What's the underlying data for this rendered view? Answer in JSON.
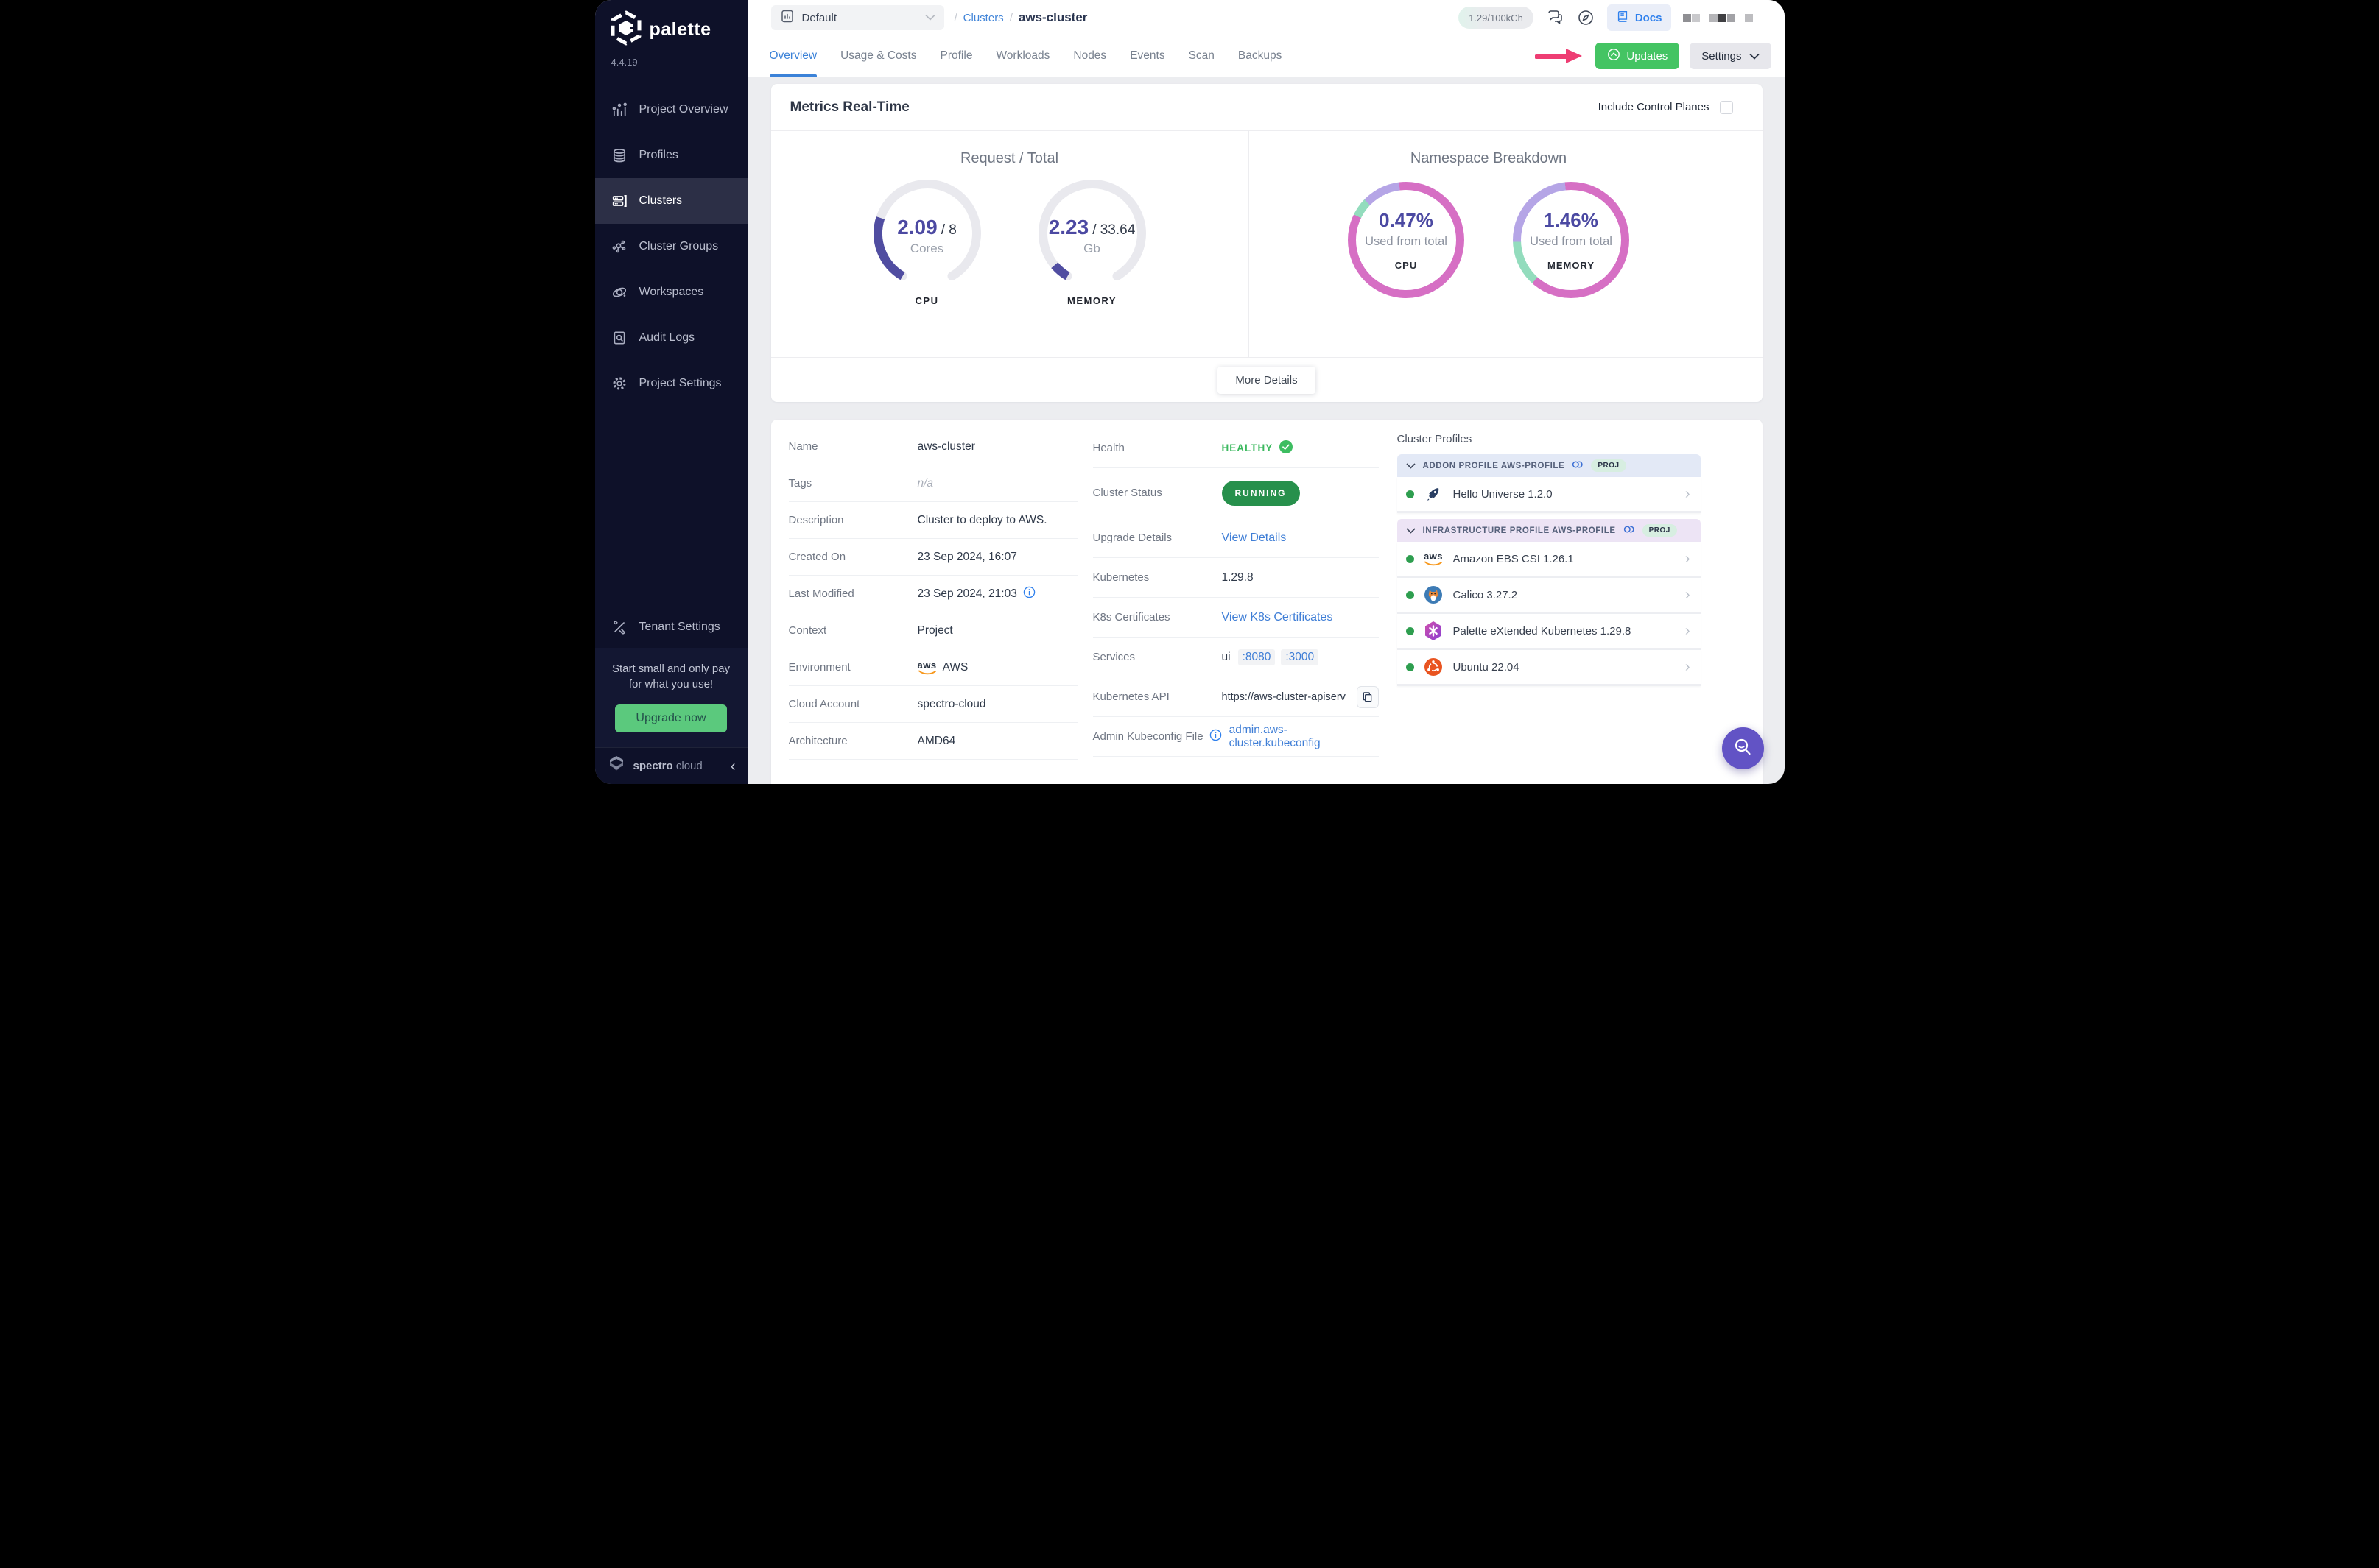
{
  "colors": {
    "sidebar_bg": "#0e1129",
    "accent_blue": "#3b82d8",
    "link_blue": "#3f7ed6",
    "green_button": "#44c463",
    "status_green": "#27904c",
    "healthy_green": "#3cb95f",
    "gauge_purple": "#504da1",
    "gauge_track": "#e9e9ee",
    "ring_pink": "#d66fc4",
    "ring_purple": "#b5a5e6",
    "ring_green": "#93dcbd",
    "promo_green": "#5bc97d",
    "annotation_pink": "#ee3d73",
    "fab_purple": "#6253c5"
  },
  "app": {
    "brand": "palette",
    "version": "4.4.19",
    "footer_brand_bold": "spectro",
    "footer_brand_light": "cloud"
  },
  "sidebar": {
    "items": [
      {
        "label": "Project Overview",
        "icon": "project-overview-icon",
        "active": false
      },
      {
        "label": "Profiles",
        "icon": "profiles-icon",
        "active": false
      },
      {
        "label": "Clusters",
        "icon": "clusters-icon",
        "active": true
      },
      {
        "label": "Cluster Groups",
        "icon": "cluster-groups-icon",
        "active": false
      },
      {
        "label": "Workspaces",
        "icon": "workspaces-icon",
        "active": false
      },
      {
        "label": "Audit Logs",
        "icon": "audit-logs-icon",
        "active": false
      },
      {
        "label": "Project Settings",
        "icon": "project-settings-icon",
        "active": false
      }
    ],
    "tenant_settings": "Tenant Settings",
    "promo": {
      "line1": "Start small and only pay",
      "line2": "for what you use!",
      "button": "Upgrade now"
    }
  },
  "topbar": {
    "project_selector": "Default",
    "breadcrumb": {
      "sep1": "/",
      "link": "Clusters",
      "sep2": "/",
      "current": "aws-cluster"
    },
    "usage_badge": "1.29/100kCh",
    "docs_label": "Docs"
  },
  "tabs": {
    "items": [
      {
        "label": "Overview",
        "active": true
      },
      {
        "label": "Usage & Costs",
        "active": false
      },
      {
        "label": "Profile",
        "active": false
      },
      {
        "label": "Workloads",
        "active": false
      },
      {
        "label": "Nodes",
        "active": false
      },
      {
        "label": "Events",
        "active": false
      },
      {
        "label": "Scan",
        "active": false
      },
      {
        "label": "Backups",
        "active": false
      }
    ]
  },
  "page_actions": {
    "updates": "Updates",
    "settings": "Settings"
  },
  "metrics_card": {
    "title": "Metrics Real-Time",
    "include_control_planes": "Include Control Planes",
    "request_total": {
      "title": "Request / Total",
      "gauges": [
        {
          "value": "2.09",
          "total": "/ 8",
          "unit": "Cores",
          "label": "CPU",
          "fraction": 0.261
        },
        {
          "value": "2.23",
          "total": "/ 33.64",
          "unit": "Gb",
          "label": "MEMORY",
          "fraction": 0.066
        }
      ]
    },
    "namespace_breakdown": {
      "title": "Namespace Breakdown",
      "rings": [
        {
          "percent": "0.47%",
          "caption": "Used from total",
          "label": "CPU",
          "segments": [
            [
              "#d66fc4",
              0,
              296
            ],
            [
              "#93dcbd",
              296,
              314
            ],
            [
              "#b5a5e6",
              314,
              353
            ],
            [
              "#d66fc4",
              353,
              360
            ]
          ]
        },
        {
          "percent": "1.46%",
          "caption": "Used from total",
          "label": "MEMORY",
          "segments": [
            [
              "#d66fc4",
              0,
              222
            ],
            [
              "#93dcbd",
              222,
              268
            ],
            [
              "#b5a5e6",
              268,
              354
            ],
            [
              "#d66fc4",
              354,
              360
            ]
          ]
        }
      ]
    },
    "more_details": "More Details"
  },
  "details": {
    "rows": [
      {
        "label": "Name",
        "value": "aws-cluster"
      },
      {
        "label": "Tags",
        "value": "n/a"
      },
      {
        "label": "Description",
        "value": "Cluster to deploy to AWS."
      },
      {
        "label": "Created On",
        "value": "23 Sep 2024, 16:07"
      },
      {
        "label": "Last Modified",
        "value": "23 Sep 2024, 21:03"
      },
      {
        "label": "Context",
        "value": "Project"
      },
      {
        "label": "Environment",
        "value": "AWS"
      },
      {
        "label": "Cloud Account",
        "value": "spectro-cloud"
      },
      {
        "label": "Architecture",
        "value": "AMD64"
      }
    ]
  },
  "status": {
    "health_label": "Health",
    "health_value": "HEALTHY",
    "cluster_status_label": "Cluster Status",
    "cluster_status_value": "RUNNING",
    "upgrade_label": "Upgrade Details",
    "upgrade_value": "View Details",
    "kubernetes_label": "Kubernetes",
    "kubernetes_value": "1.29.8",
    "certs_label": "K8s Certificates",
    "certs_value": "View K8s Certificates",
    "services_label": "Services",
    "services_name": "ui",
    "services_ports": [
      ":8080",
      ":3000"
    ],
    "api_label": "Kubernetes API",
    "api_value": "https://aws-cluster-apiserve...",
    "kubeconfig_label": "Admin Kubeconfig File",
    "kubeconfig_value": "admin.aws-cluster.kubeconfig"
  },
  "profiles": {
    "heading": "Cluster Profiles",
    "groups": [
      {
        "title": "ADDON PROFILE AWS-PROFILE",
        "badge": "PROJ",
        "theme": "blue",
        "items": [
          {
            "name": "Hello Universe 1.2.0",
            "icon": "hello-universe-icon"
          }
        ]
      },
      {
        "title": "INFRASTRUCTURE PROFILE AWS-PROFILE",
        "badge": "PROJ",
        "theme": "purple",
        "items": [
          {
            "name": "Amazon EBS CSI 1.26.1",
            "icon": "aws-icon"
          },
          {
            "name": "Calico 3.27.2",
            "icon": "calico-icon"
          },
          {
            "name": "Palette eXtended Kubernetes 1.29.8",
            "icon": "pxk-icon"
          },
          {
            "name": "Ubuntu 22.04",
            "icon": "ubuntu-icon"
          }
        ]
      }
    ]
  }
}
